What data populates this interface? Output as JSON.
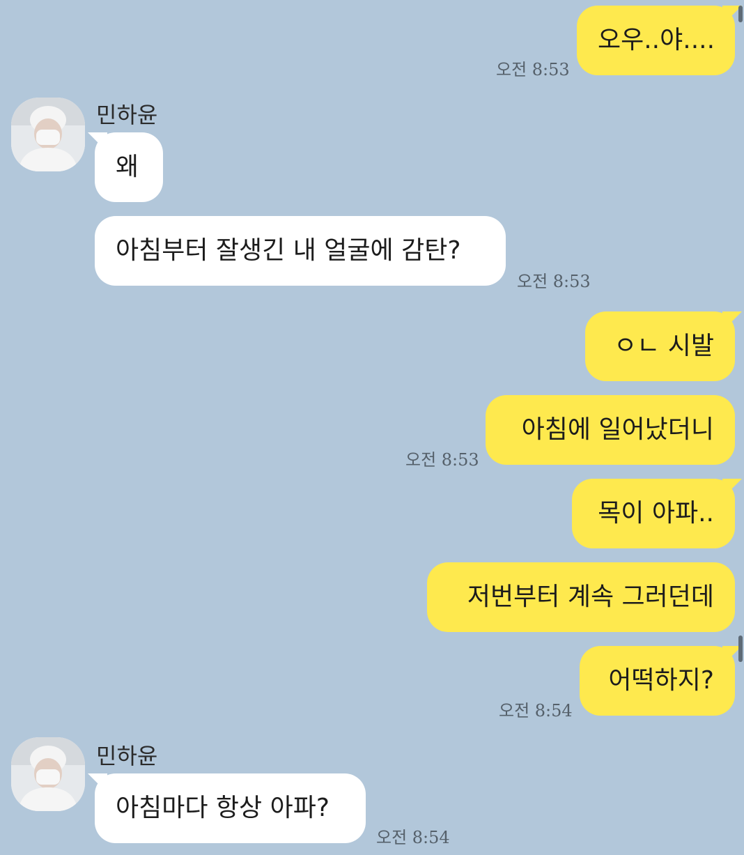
{
  "messages": [
    {
      "sender": "me",
      "text": "오우..야....",
      "time": "오전 8:53"
    },
    {
      "sender": "민하윤",
      "text": "왜",
      "time": ""
    },
    {
      "sender": "민하윤",
      "text": "아침부터 잘생긴 내 얼굴에 감탄?",
      "time": "오전 8:53"
    },
    {
      "sender": "me",
      "text": "ㅇㄴ 시발",
      "time": ""
    },
    {
      "sender": "me",
      "text": "아침에 일어났더니",
      "time": "오전 8:53"
    },
    {
      "sender": "me",
      "text": "목이 아파..",
      "time": ""
    },
    {
      "sender": "me",
      "text": "저번부터 계속 그러던데",
      "time": ""
    },
    {
      "sender": "me",
      "text": "어떡하지?",
      "time": "오전 8:54"
    },
    {
      "sender": "민하윤",
      "text": "아침마다 항상 아파?",
      "time": "오전 8:54"
    }
  ],
  "contact": {
    "name": "민하윤",
    "avatar_icon": "profile-photo-masked-person"
  },
  "colors": {
    "background": "#b2c7da",
    "my_bubble": "#fee94e",
    "their_bubble": "#ffffff",
    "timestamp": "#55606a"
  }
}
